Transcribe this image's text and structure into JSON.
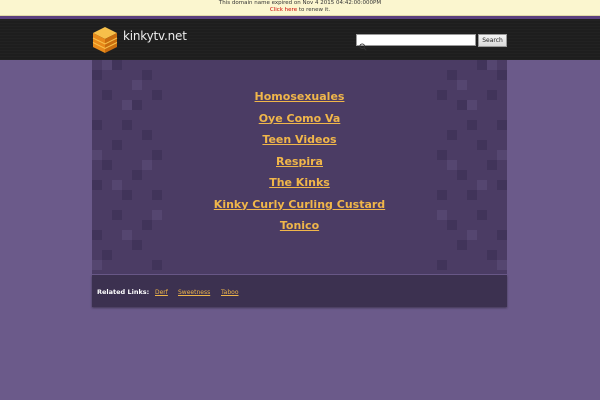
{
  "notice": {
    "expired_text": "This domain name expired on Nov 4 2015 04:42:00:000PM",
    "renew_link": "Click here",
    "renew_suffix": " to renew it."
  },
  "header": {
    "site_name": "kinkytv.net",
    "logo_icon": "cube-icon",
    "search_placeholder": "",
    "search_value": "",
    "search_button": "Search"
  },
  "main": {
    "links": [
      "Homosexuales",
      "Oye Como Va",
      "Teen Videos",
      "Respira",
      "The Kinks",
      "Kinky Curly Curling Custard",
      "Tonico"
    ]
  },
  "related": {
    "label": "Related Links:",
    "links": [
      "Derf",
      "Sweetness",
      "Taboo"
    ]
  },
  "colors": {
    "background": "#6b5a8a",
    "panel": "#4b3c64",
    "link": "#f0b64a",
    "header": "#1e1e1e"
  }
}
